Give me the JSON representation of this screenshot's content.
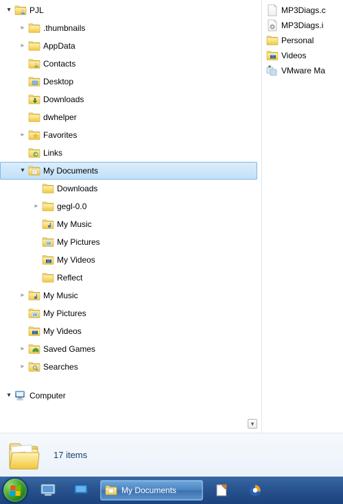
{
  "tree": [
    {
      "indent": 0,
      "expander": "expanded",
      "icon": "user-folder",
      "label": "PJL"
    },
    {
      "indent": 1,
      "expander": "collapsed",
      "icon": "folder",
      "label": ".thumbnails"
    },
    {
      "indent": 1,
      "expander": "collapsed",
      "icon": "folder",
      "label": "AppData"
    },
    {
      "indent": 1,
      "expander": "none",
      "icon": "contacts-folder",
      "label": "Contacts"
    },
    {
      "indent": 1,
      "expander": "none",
      "icon": "desktop-folder",
      "label": "Desktop"
    },
    {
      "indent": 1,
      "expander": "none",
      "icon": "downloads-folder",
      "label": "Downloads"
    },
    {
      "indent": 1,
      "expander": "none",
      "icon": "folder",
      "label": "dwhelper"
    },
    {
      "indent": 1,
      "expander": "collapsed",
      "icon": "favorites-folder",
      "label": "Favorites"
    },
    {
      "indent": 1,
      "expander": "none",
      "icon": "links-folder",
      "label": "Links"
    },
    {
      "indent": 1,
      "expander": "expanded",
      "icon": "documents-folder",
      "label": "My Documents",
      "selected": true
    },
    {
      "indent": 2,
      "expander": "none",
      "icon": "folder",
      "label": "Downloads"
    },
    {
      "indent": 2,
      "expander": "collapsed",
      "icon": "folder",
      "label": "gegl-0.0"
    },
    {
      "indent": 2,
      "expander": "none",
      "icon": "music-folder",
      "label": "My Music"
    },
    {
      "indent": 2,
      "expander": "none",
      "icon": "pictures-folder",
      "label": "My Pictures"
    },
    {
      "indent": 2,
      "expander": "none",
      "icon": "videos-folder",
      "label": "My Videos"
    },
    {
      "indent": 2,
      "expander": "none",
      "icon": "folder",
      "label": "Reflect"
    },
    {
      "indent": 1,
      "expander": "collapsed",
      "icon": "music-folder",
      "label": "My Music"
    },
    {
      "indent": 1,
      "expander": "none",
      "icon": "pictures-folder",
      "label": "My Pictures"
    },
    {
      "indent": 1,
      "expander": "none",
      "icon": "videos-folder",
      "label": "My Videos"
    },
    {
      "indent": 1,
      "expander": "collapsed",
      "icon": "savedgames-folder",
      "label": "Saved Games"
    },
    {
      "indent": 1,
      "expander": "collapsed",
      "icon": "searches-folder",
      "label": "Searches"
    },
    {
      "gap": true
    },
    {
      "indent": 0,
      "expander": "expanded",
      "icon": "computer",
      "label": "Computer"
    }
  ],
  "content": [
    {
      "icon": "file-generic",
      "label": "MP3Diags.c"
    },
    {
      "icon": "file-ini",
      "label": "MP3Diags.i"
    },
    {
      "icon": "folder",
      "label": "Personal"
    },
    {
      "icon": "videos-folder",
      "label": "Videos"
    },
    {
      "icon": "vmware",
      "label": "VMware Ma"
    }
  ],
  "details": {
    "count_text": "17 items"
  },
  "taskbar": {
    "active_task_label": "My Documents"
  }
}
